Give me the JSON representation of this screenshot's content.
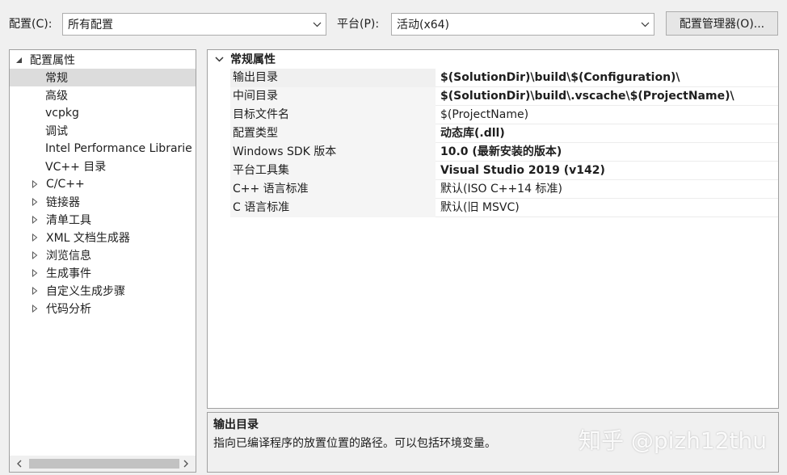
{
  "toolbar": {
    "config_label": "配置(C):",
    "config_value": "所有配置",
    "platform_label": "平台(P):",
    "platform_value": "活动(x64)",
    "manager_button": "配置管理器(O)..."
  },
  "tree": {
    "root": "配置属性",
    "items": [
      {
        "label": "常规",
        "selected": true,
        "expandable": false
      },
      {
        "label": "高级",
        "expandable": false
      },
      {
        "label": "vcpkg",
        "expandable": false
      },
      {
        "label": "调试",
        "expandable": false
      },
      {
        "label": "Intel Performance Librarie",
        "expandable": false
      },
      {
        "label": "VC++ 目录",
        "expandable": false
      },
      {
        "label": "C/C++",
        "expandable": true
      },
      {
        "label": "链接器",
        "expandable": true
      },
      {
        "label": "清单工具",
        "expandable": true
      },
      {
        "label": "XML 文档生成器",
        "expandable": true
      },
      {
        "label": "浏览信息",
        "expandable": true
      },
      {
        "label": "生成事件",
        "expandable": true
      },
      {
        "label": "自定义生成步骤",
        "expandable": true
      },
      {
        "label": "代码分析",
        "expandable": true
      }
    ]
  },
  "grid": {
    "category": "常规属性",
    "rows": [
      {
        "name": "输出目录",
        "value": "$(SolutionDir)\\build\\$(Configuration)\\",
        "bold": true
      },
      {
        "name": "中间目录",
        "value": "$(SolutionDir)\\build\\.vscache\\$(ProjectName)\\",
        "bold": true
      },
      {
        "name": "目标文件名",
        "value": "$(ProjectName)",
        "bold": false
      },
      {
        "name": "配置类型",
        "value": "动态库(.dll)",
        "bold": true
      },
      {
        "name": "Windows SDK 版本",
        "value": "10.0 (最新安装的版本)",
        "bold": true
      },
      {
        "name": "平台工具集",
        "value": "Visual Studio 2019 (v142)",
        "bold": true
      },
      {
        "name": "C++ 语言标准",
        "value": "默认(ISO C++14 标准)",
        "bold": false
      },
      {
        "name": "C 语言标准",
        "value": "默认(旧 MSVC)",
        "bold": false
      }
    ]
  },
  "description": {
    "title": "输出目录",
    "text": "指向已编译程序的放置位置的路径。可以包括环境变量。"
  },
  "watermark": "知乎 @pizh12thu"
}
